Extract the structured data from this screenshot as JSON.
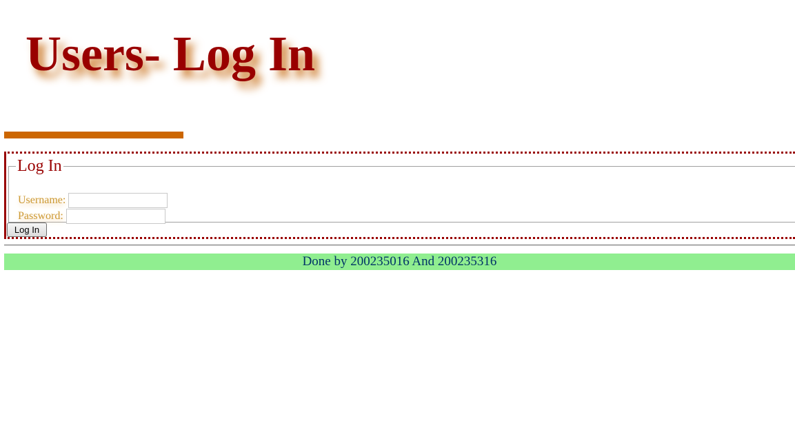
{
  "header": {
    "title": "Users- Log In"
  },
  "login_form": {
    "legend": "Log In",
    "username_label": "Username:",
    "username_value": "",
    "password_label": "Password:",
    "password_value": "",
    "submit_label": "Log In"
  },
  "footer": {
    "text": "Done by 200235016 And 200235316"
  },
  "colors": {
    "title": "#990000",
    "title_shadow": "#cc7a2a",
    "accent_bar": "#cc6600",
    "label": "#cc9933",
    "footer_bg": "#90ee90",
    "footer_text": "#003366"
  }
}
